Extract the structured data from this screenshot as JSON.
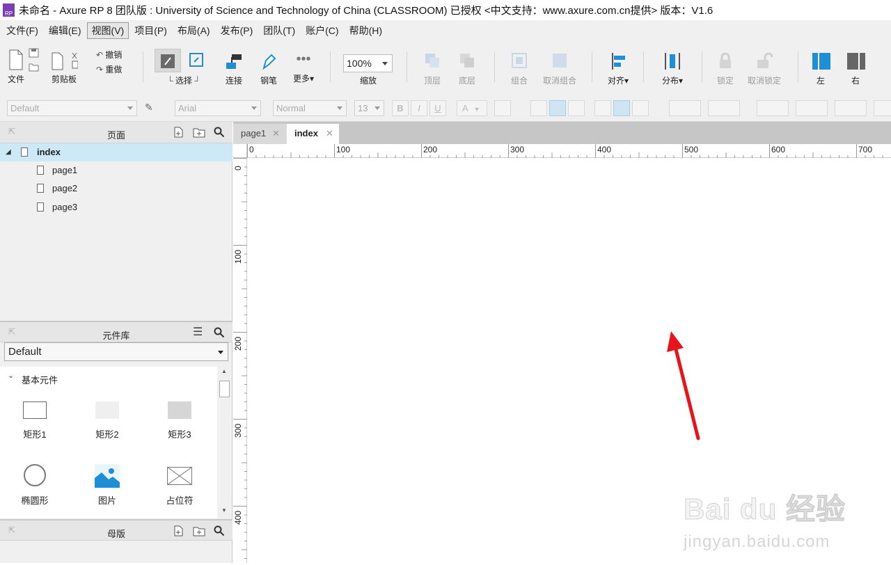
{
  "title_bar": {
    "text": "未命名 - Axure RP 8 团队版 : University of Science and Technology of China (CLASSROOM) 已授权    <中文支持：www.axure.com.cn提供> 版本：V1.6",
    "logo_text": "RP"
  },
  "menu": [
    "文件(F)",
    "编辑(E)",
    "视图(V)",
    "项目(P)",
    "布局(A)",
    "发布(P)",
    "团队(T)",
    "账户(C)",
    "帮助(H)"
  ],
  "toolbar": {
    "file": "文件",
    "clipboard": "剪贴板",
    "undo": "撤销",
    "redo": "重做",
    "select": "选择",
    "connect": "连接",
    "pen": "钢笔",
    "more": "更多▾",
    "zoom_value": "100%",
    "zoom": "缩放",
    "top_layer": "顶层",
    "bottom_layer": "底层",
    "group": "组合",
    "ungroup": "取消组合",
    "align": "对齐▾",
    "distribute": "分布▾",
    "lock": "锁定",
    "unlock": "取消锁定",
    "left": "左",
    "right": "右"
  },
  "format_bar": {
    "style": "Default",
    "font": "Arial",
    "weight": "Normal",
    "size": "13",
    "bold": "B",
    "italic": "I",
    "underline": "U",
    "font_color": "A"
  },
  "pages_panel": {
    "title": "页面",
    "pages": [
      "index",
      "page1",
      "page2",
      "page3"
    ]
  },
  "widgets_panel": {
    "title": "元件库",
    "library": "Default",
    "section": "基本元件",
    "items": [
      "矩形1",
      "矩形2",
      "矩形3",
      "椭圆形",
      "图片",
      "占位符"
    ]
  },
  "masters_panel": {
    "title": "母版"
  },
  "tabs": [
    "page1",
    "index"
  ],
  "ruler": {
    "h_labels": [
      "0",
      "100",
      "200",
      "300",
      "400",
      "500",
      "600",
      "700"
    ],
    "v_labels": [
      "0",
      "100",
      "200",
      "300",
      "400"
    ]
  },
  "watermark": {
    "brand": "Bai du 经验",
    "url": "jingyan.baidu.com"
  },
  "colors": {
    "accent": "#1e90d6",
    "annotation_arrow": "#e8141b",
    "selected_row": "#cde8f6"
  }
}
